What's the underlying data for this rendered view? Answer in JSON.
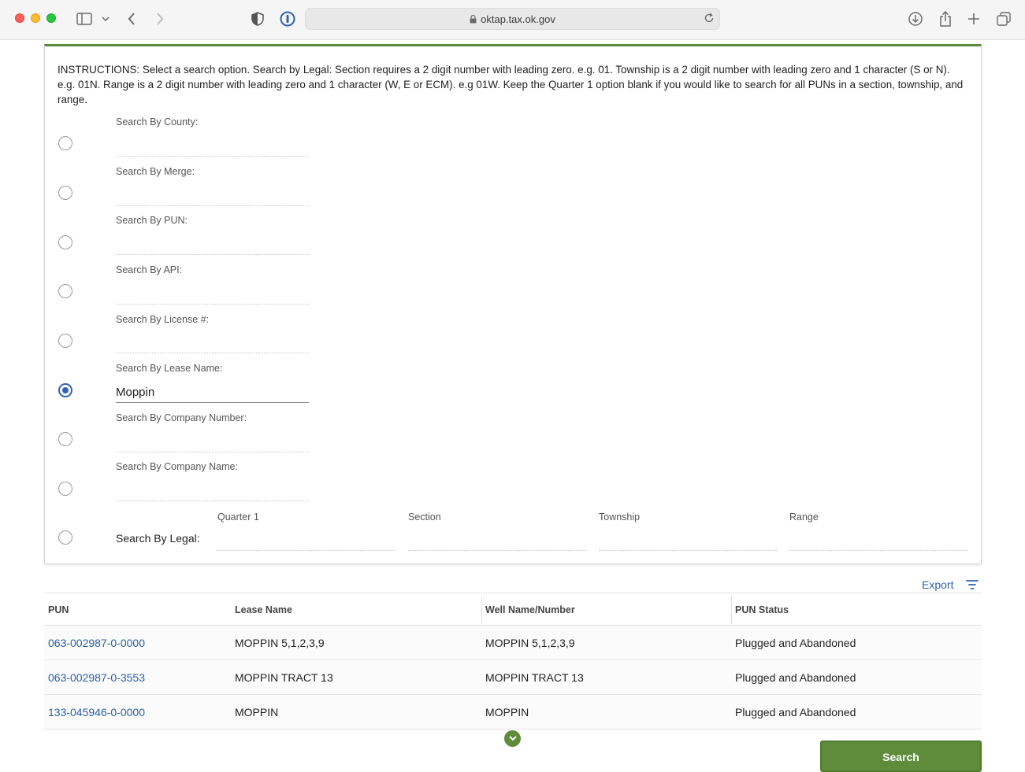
{
  "browser": {
    "url": "oktap.tax.ok.gov"
  },
  "form": {
    "instructions": "INSTRUCTIONS: Select a search option. Search by Legal: Section requires a 2 digit number with leading zero. e.g. 01. Township is a 2 digit number with leading zero and 1 character (S or N). e.g. 01N. Range is a 2 digit number with leading zero and 1 character (W, E or ECM). e.g 01W. Keep the Quarter 1 option blank if you would like to search for all PUNs in a section, township, and range.",
    "options": [
      {
        "label": "Search By County:",
        "value": "",
        "checked": false
      },
      {
        "label": "Search By Merge:",
        "value": "",
        "checked": false
      },
      {
        "label": "Search By PUN:",
        "value": "",
        "checked": false
      },
      {
        "label": "Search By API:",
        "value": "",
        "checked": false
      },
      {
        "label": "Search By License #:",
        "value": "",
        "checked": false
      },
      {
        "label": "Search By Lease Name:",
        "value": "Moppin",
        "checked": true
      },
      {
        "label": "Search By Company Number:",
        "value": "",
        "checked": false
      },
      {
        "label": "Search By Company Name:",
        "value": "",
        "checked": false
      }
    ],
    "legal": {
      "label": "Search By Legal:",
      "checked": false,
      "quarter_label": "Quarter 1",
      "section_label": "Section",
      "township_label": "Township",
      "range_label": "Range"
    }
  },
  "results": {
    "export_label": "Export",
    "columns": [
      "PUN",
      "Lease Name",
      "Well Name/Number",
      "PUN Status"
    ],
    "rows": [
      [
        "063-002987-0-0000",
        "MOPPIN 5,1,2,3,9",
        "MOPPIN 5,1,2,3,9",
        "Plugged and Abandoned"
      ],
      [
        "063-002987-0-3553",
        "MOPPIN TRACT 13",
        "MOPPIN TRACT 13",
        "Plugged and Abandoned"
      ],
      [
        "133-045946-0-0000",
        "MOPPIN",
        "MOPPIN",
        "Plugged and Abandoned"
      ]
    ]
  },
  "search_button": "Search",
  "colors": {
    "accent_green": "#5e8c3b",
    "link_blue": "#2a5fa8",
    "radio_blue": "#2f62b5"
  }
}
